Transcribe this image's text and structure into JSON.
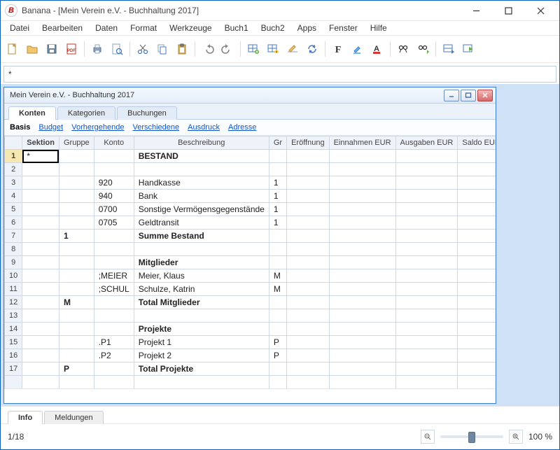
{
  "app": {
    "title": "Banana - [Mein Verein e.V. - Buchhaltung 2017]",
    "icon_glyph": "B"
  },
  "menubar": [
    "Datei",
    "Bearbeiten",
    "Daten",
    "Format",
    "Werkzeuge",
    "Buch1",
    "Buch2",
    "Apps",
    "Fenster",
    "Hilfe"
  ],
  "formula_value": "*",
  "inner_title": "Mein Verein e.V. - Buchhaltung 2017",
  "tabs": [
    {
      "label": "Konten",
      "active": true
    },
    {
      "label": "Kategorien",
      "active": false
    },
    {
      "label": "Buchungen",
      "active": false
    }
  ],
  "subtabs": [
    {
      "label": "Basis",
      "active": true
    },
    {
      "label": "Budget",
      "active": false
    },
    {
      "label": "Vorhergehende",
      "active": false
    },
    {
      "label": "Verschiedene",
      "active": false
    },
    {
      "label": "Ausdruck",
      "active": false
    },
    {
      "label": "Adresse",
      "active": false
    }
  ],
  "columns": {
    "sektion": "Sektion",
    "gruppe": "Gruppe",
    "konto": "Konto",
    "beschreibung": "Beschreibung",
    "gr": "Gr",
    "eroeffnung": "Eröffnung",
    "einnahmen": "Einnahmen EUR",
    "ausgaben": "Ausgaben EUR",
    "saldo": "Saldo EUR"
  },
  "rows": [
    {
      "n": "1",
      "sektion": "*",
      "gruppe": "",
      "konto": "",
      "beschreibung": "BESTAND",
      "gr": "",
      "bold": true,
      "current": true
    },
    {
      "n": "2",
      "sektion": "",
      "gruppe": "",
      "konto": "",
      "beschreibung": "",
      "gr": ""
    },
    {
      "n": "3",
      "sektion": "",
      "gruppe": "",
      "konto": "920",
      "beschreibung": "Handkasse",
      "gr": "1"
    },
    {
      "n": "4",
      "sektion": "",
      "gruppe": "",
      "konto": "940",
      "beschreibung": "Bank",
      "gr": "1"
    },
    {
      "n": "5",
      "sektion": "",
      "gruppe": "",
      "konto": "0700",
      "beschreibung": "Sonstige Vermögensgegenstände",
      "gr": "1"
    },
    {
      "n": "6",
      "sektion": "",
      "gruppe": "",
      "konto": "0705",
      "beschreibung": "Geldtransit",
      "gr": "1"
    },
    {
      "n": "7",
      "sektion": "",
      "gruppe": "1",
      "konto": "",
      "beschreibung": "Summe Bestand",
      "gr": "",
      "bold": true
    },
    {
      "n": "8",
      "sektion": "",
      "gruppe": "",
      "konto": "",
      "beschreibung": "",
      "gr": ""
    },
    {
      "n": "9",
      "sektion": "",
      "gruppe": "",
      "konto": "",
      "beschreibung": "Mitglieder",
      "gr": "",
      "bold": true
    },
    {
      "n": "10",
      "sektion": "",
      "gruppe": "",
      "konto": ";MEIER",
      "beschreibung": "Meier, Klaus",
      "gr": "M"
    },
    {
      "n": "11",
      "sektion": "",
      "gruppe": "",
      "konto": ";SCHUL",
      "beschreibung": "Schulze, Katrin",
      "gr": "M"
    },
    {
      "n": "12",
      "sektion": "",
      "gruppe": "M",
      "konto": "",
      "beschreibung": "Total Mitglieder",
      "gr": "",
      "bold": true
    },
    {
      "n": "13",
      "sektion": "",
      "gruppe": "",
      "konto": "",
      "beschreibung": "",
      "gr": ""
    },
    {
      "n": "14",
      "sektion": "",
      "gruppe": "",
      "konto": "",
      "beschreibung": "Projekte",
      "gr": "",
      "bold": true
    },
    {
      "n": "15",
      "sektion": "",
      "gruppe": "",
      "konto": ".P1",
      "beschreibung": "Projekt 1",
      "gr": "P"
    },
    {
      "n": "16",
      "sektion": "",
      "gruppe": "",
      "konto": ".P2",
      "beschreibung": "Projekt 2",
      "gr": "P"
    },
    {
      "n": "17",
      "sektion": "",
      "gruppe": "P",
      "konto": "",
      "beschreibung": "Total Projekte",
      "gr": "",
      "bold": true
    },
    {
      "n": "",
      "sektion": "",
      "gruppe": "",
      "konto": "",
      "beschreibung": "",
      "gr": ""
    }
  ],
  "bottom_tabs": [
    {
      "label": "Info",
      "active": true
    },
    {
      "label": "Meldungen",
      "active": false
    }
  ],
  "status": {
    "page": "1/18",
    "zoom": "100 %"
  },
  "colors": {
    "accent": "#3a7bd5"
  }
}
